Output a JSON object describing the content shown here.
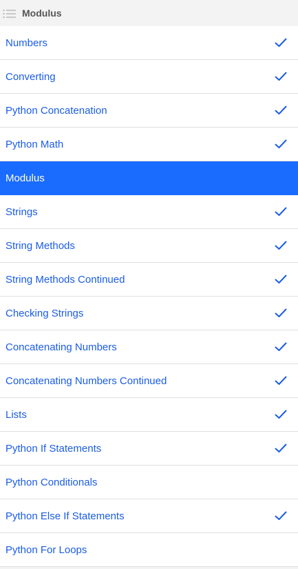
{
  "header": {
    "title": "Modulus",
    "icon": "list-icon"
  },
  "colors": {
    "link": "#1a5ce6",
    "active_bg": "#1a6bff",
    "check": "#1a5ce6"
  },
  "items": [
    {
      "label": "Numbers",
      "completed": true,
      "active": false
    },
    {
      "label": "Converting",
      "completed": true,
      "active": false
    },
    {
      "label": "Python Concatenation",
      "completed": true,
      "active": false
    },
    {
      "label": "Python Math",
      "completed": true,
      "active": false
    },
    {
      "label": "Modulus",
      "completed": false,
      "active": true
    },
    {
      "label": "Strings",
      "completed": true,
      "active": false
    },
    {
      "label": "String Methods",
      "completed": true,
      "active": false
    },
    {
      "label": "String Methods Continued",
      "completed": true,
      "active": false
    },
    {
      "label": "Checking Strings",
      "completed": true,
      "active": false
    },
    {
      "label": "Concatenating Numbers",
      "completed": true,
      "active": false
    },
    {
      "label": "Concatenating Numbers Continued",
      "completed": true,
      "active": false
    },
    {
      "label": "Lists",
      "completed": true,
      "active": false
    },
    {
      "label": "Python If Statements",
      "completed": true,
      "active": false
    },
    {
      "label": "Python Conditionals",
      "completed": false,
      "active": false
    },
    {
      "label": "Python Else If Statements",
      "completed": true,
      "active": false
    },
    {
      "label": "Python For Loops",
      "completed": false,
      "active": false
    }
  ]
}
